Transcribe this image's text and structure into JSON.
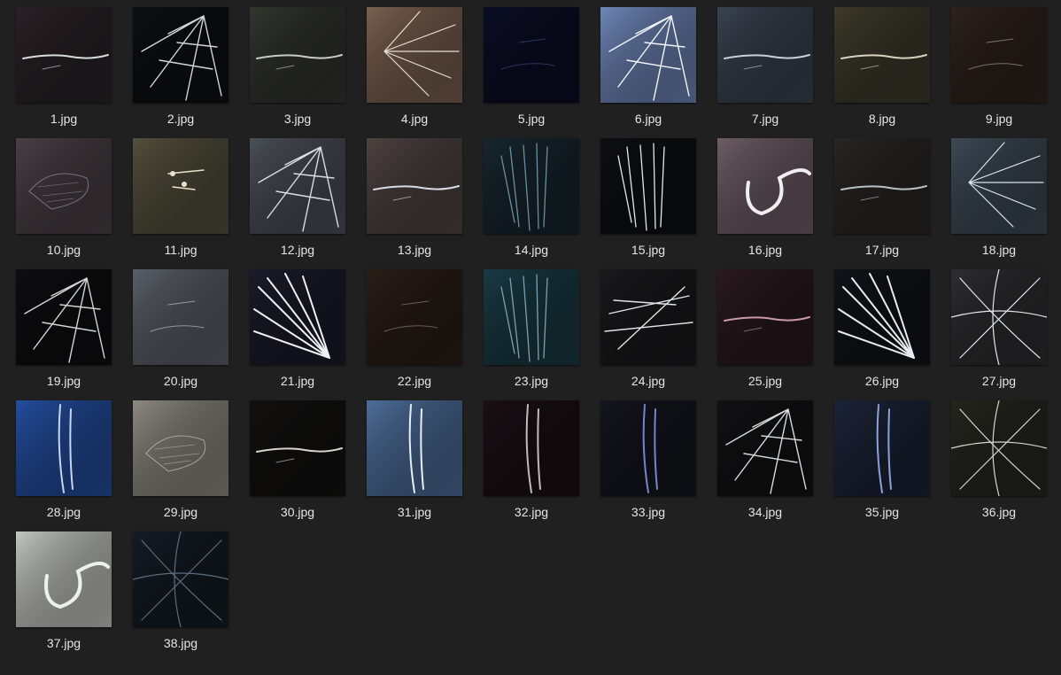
{
  "window": {
    "background": "#202020",
    "label_color": "#e6e6e6"
  },
  "files": [
    {
      "name": "1.jpg",
      "bg": "#2a2226",
      "crack": "#d8dce0",
      "style": "line"
    },
    {
      "name": "2.jpg",
      "bg": "#0c1013",
      "crack": "#cfd6da",
      "style": "shatter"
    },
    {
      "name": "3.jpg",
      "bg": "#33352f",
      "crack": "#c8ccc4",
      "style": "line"
    },
    {
      "name": "4.jpg",
      "bg": "#7a6152",
      "crack": "#e8ddd2",
      "style": "radial"
    },
    {
      "name": "5.jpg",
      "bg": "#0b0d24",
      "crack": "#3a4a7a",
      "style": "faint"
    },
    {
      "name": "6.jpg",
      "bg": "#6f86b8",
      "crack": "#f2f5fb",
      "style": "shatter"
    },
    {
      "name": "7.jpg",
      "bg": "#3a4350",
      "crack": "#c9d0d8",
      "style": "line"
    },
    {
      "name": "8.jpg",
      "bg": "#3e3a2c",
      "crack": "#d8d2c0",
      "style": "line"
    },
    {
      "name": "9.jpg",
      "bg": "#2e221c",
      "crack": "#a8948a",
      "style": "faint"
    },
    {
      "name": "10.jpg",
      "bg": "#4a4146",
      "crack": "#a8a4aa",
      "style": "texture"
    },
    {
      "name": "11.jpg",
      "bg": "#54503e",
      "crack": "#e8e2c8",
      "style": "spots"
    },
    {
      "name": "12.jpg",
      "bg": "#4b5057",
      "crack": "#d8dee4",
      "style": "shatter"
    },
    {
      "name": "13.jpg",
      "bg": "#4e4442",
      "crack": "#d6dce6",
      "style": "line"
    },
    {
      "name": "14.jpg",
      "bg": "#17262e",
      "crack": "#6e8e9e",
      "style": "streaks"
    },
    {
      "name": "15.jpg",
      "bg": "#0d0f14",
      "crack": "#e4e8ee",
      "style": "streaks"
    },
    {
      "name": "16.jpg",
      "bg": "#6e5e66",
      "crack": "#f0eef0",
      "style": "loop"
    },
    {
      "name": "17.jpg",
      "bg": "#2a2624",
      "crack": "#b8c0c8",
      "style": "line"
    },
    {
      "name": "18.jpg",
      "bg": "#3e4a56",
      "crack": "#dce4ea",
      "style": "radial"
    },
    {
      "name": "19.jpg",
      "bg": "#0e0e10",
      "crack": "#cfd4d8",
      "style": "shatter"
    },
    {
      "name": "20.jpg",
      "bg": "#5b6068",
      "crack": "#b8bec6",
      "style": "faint"
    },
    {
      "name": "21.jpg",
      "bg": "#1a1c2a",
      "crack": "#eef0f4",
      "style": "fan"
    },
    {
      "name": "22.jpg",
      "bg": "#2a1e18",
      "crack": "#8a7a70",
      "style": "faint"
    },
    {
      "name": "23.jpg",
      "bg": "#1a3a44",
      "crack": "#7ea0ae",
      "style": "streaks"
    },
    {
      "name": "24.jpg",
      "bg": "#1a1a1c",
      "crack": "#e2e4e6",
      "style": "lines"
    },
    {
      "name": "25.jpg",
      "bg": "#2a1a20",
      "crack": "#c89aa2",
      "style": "line"
    },
    {
      "name": "26.jpg",
      "bg": "#101418",
      "crack": "#e6ecf2",
      "style": "fan"
    },
    {
      "name": "27.jpg",
      "bg": "#2e2e30",
      "crack": "#e4e6e8",
      "style": "web"
    },
    {
      "name": "28.jpg",
      "bg": "#244ea0",
      "crack": "#c8d6f2",
      "style": "vertical"
    },
    {
      "name": "29.jpg",
      "bg": "#8e8a82",
      "crack": "#d8d6d0",
      "style": "texture"
    },
    {
      "name": "30.jpg",
      "bg": "#121110",
      "crack": "#d6d4d0",
      "style": "line"
    },
    {
      "name": "31.jpg",
      "bg": "#4e6e9a",
      "crack": "#e6eef8",
      "style": "vertical"
    },
    {
      "name": "32.jpg",
      "bg": "#1a1014",
      "crack": "#c4b8bc",
      "style": "vertical"
    },
    {
      "name": "33.jpg",
      "bg": "#14161e",
      "crack": "#7884c8",
      "style": "vertical"
    },
    {
      "name": "34.jpg",
      "bg": "#121214",
      "crack": "#d6dade",
      "style": "shatter"
    },
    {
      "name": "35.jpg",
      "bg": "#1c2438",
      "crack": "#8ea2d8",
      "style": "vertical"
    },
    {
      "name": "36.jpg",
      "bg": "#262620",
      "crack": "#d4d6ce",
      "style": "web"
    },
    {
      "name": "37.jpg",
      "bg": "#c4c6c2",
      "crack": "#eef0ec",
      "style": "loop"
    },
    {
      "name": "38.jpg",
      "bg": "#141c24",
      "crack": "#5c6c7c",
      "style": "web"
    }
  ]
}
